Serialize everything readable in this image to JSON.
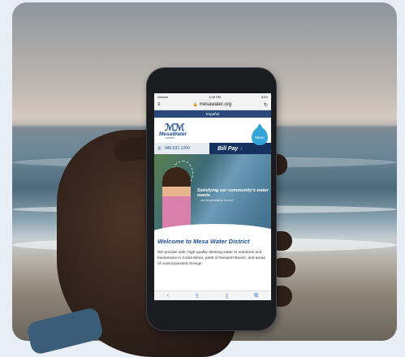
{
  "status_bar": {
    "carrier": "Verizon",
    "time": "1:09 PM",
    "battery": "51%"
  },
  "browser": {
    "url": "mesawater.org",
    "menu_icon": "hamburger-icon",
    "reload_icon": "reload-icon"
  },
  "site": {
    "language_link": "Español",
    "logo_mark": "ℳℳ",
    "logo_text": "MesaWater",
    "logo_sub": "DISTRICT",
    "menu_label": "Menu",
    "phone": "949.631.1200",
    "bill_pay": "Bill Pay",
    "hero_title": "Satisfying our community's water needs",
    "hero_sub": "...and for generations to come",
    "welcome": "Welcome to Mesa Water District",
    "intro": "We provide safe, high-quality drinking water to residents and businesses in Costa Mesa, parts of Newport Beach, and areas of unincorporated Orange"
  },
  "toolbar": [
    "‹",
    "⇪",
    "▯",
    "⧉"
  ],
  "colors": {
    "brand": "#1e4c8a",
    "dark_navy": "#15325e",
    "accent_drop": "#34a5d8"
  }
}
